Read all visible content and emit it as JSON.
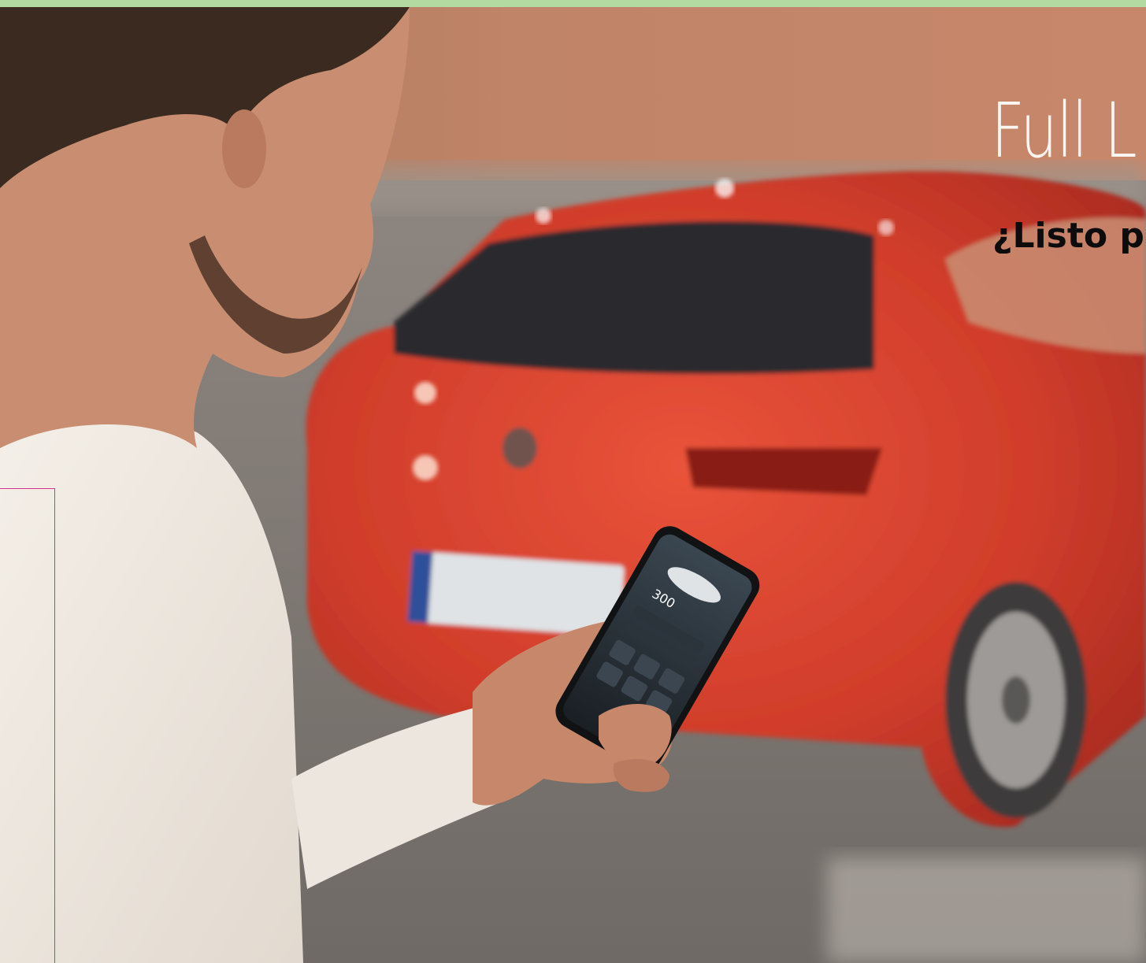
{
  "hero": {
    "title": "Full L",
    "subtitle": "¿Listo p"
  },
  "colors": {
    "top_band": "#b3dba1",
    "car_red": "#d8412e",
    "wall": "#b87a5b",
    "sweater": "#efe9e2",
    "frame_accent": "#d2358c"
  },
  "phone_screen": {
    "range": "300"
  }
}
